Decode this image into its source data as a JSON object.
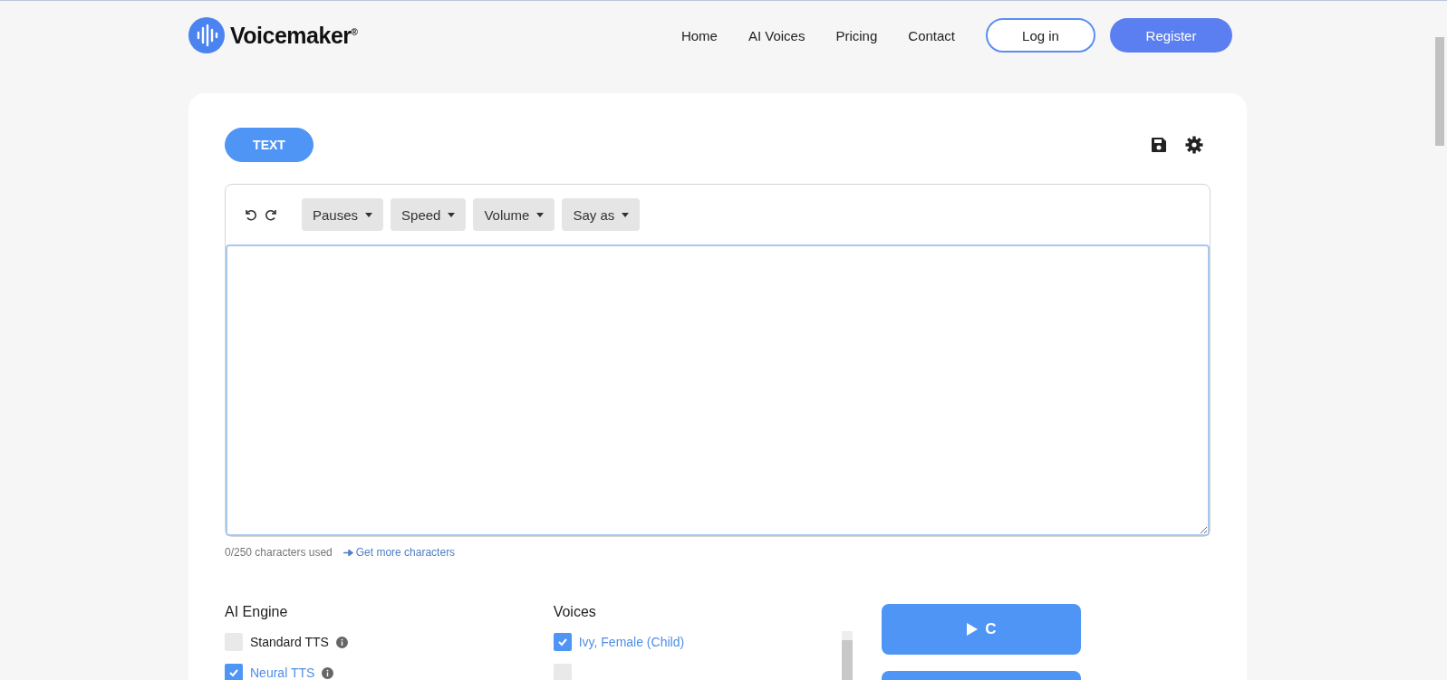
{
  "header": {
    "logo": "Voicemaker",
    "logo_mark": "®",
    "nav": [
      "Home",
      "AI Voices",
      "Pricing",
      "Contact"
    ],
    "login": "Log in",
    "register": "Register"
  },
  "mode_tabs": [
    {
      "label": "TEXT",
      "selected": true
    }
  ],
  "toolbar": {
    "menus": [
      "Pauses",
      "Speed",
      "Volume",
      "Say as"
    ]
  },
  "char_count": "0/250 characters used",
  "more_link": "Get more characters",
  "engine": {
    "title": "AI Engine",
    "options": [
      {
        "label": "Standard TTS",
        "checked": false
      },
      {
        "label": "Neural TTS",
        "checked": true
      }
    ]
  },
  "voices": {
    "title": "Voices",
    "items": [
      {
        "label": "Ivy, Female (Child)",
        "checked": true
      },
      {
        "checked": false
      }
    ]
  },
  "convert_button": "C"
}
